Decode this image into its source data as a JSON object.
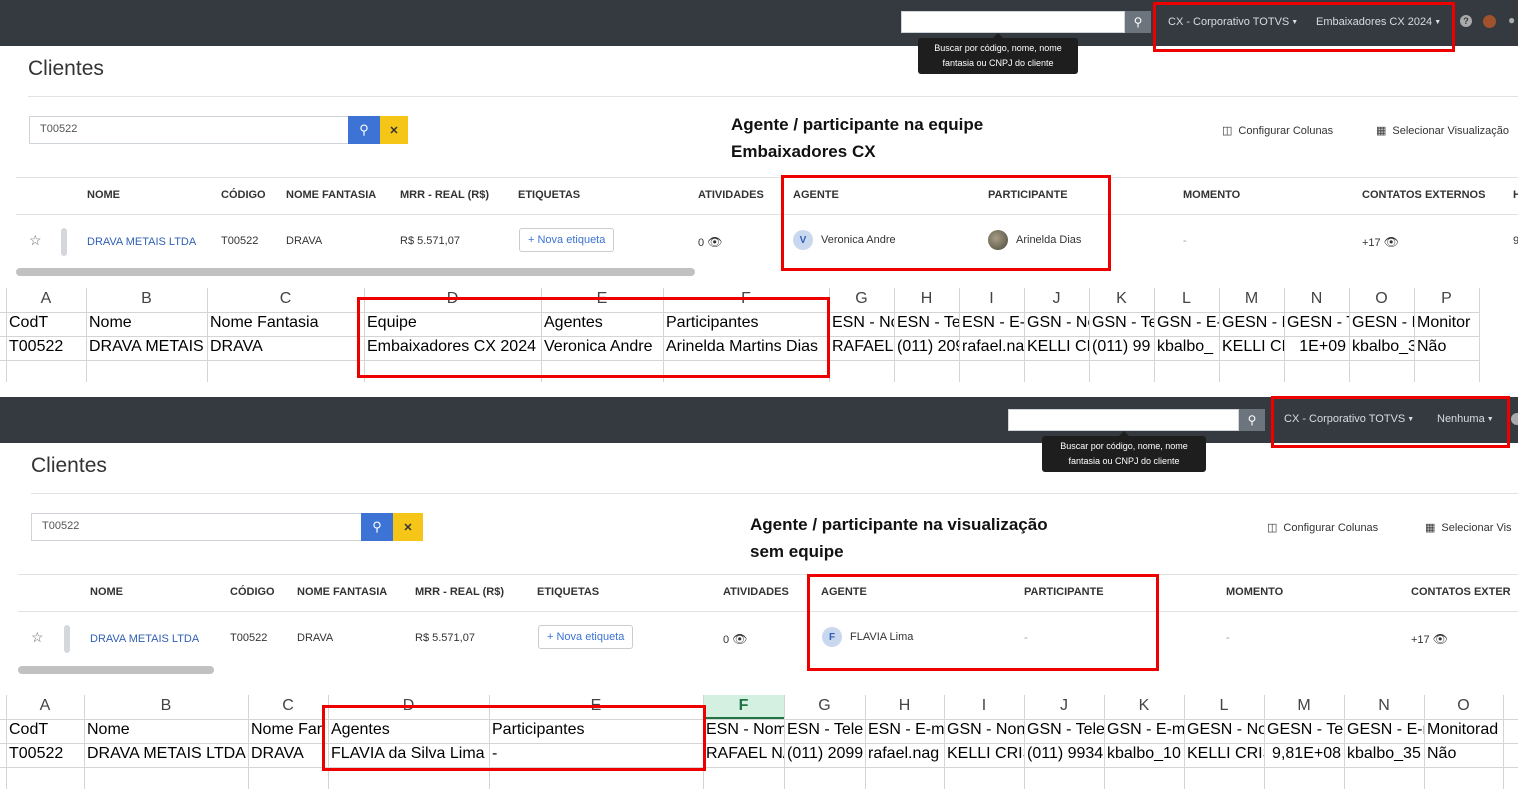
{
  "top": {
    "nav": {
      "search_value": "",
      "tooltip_line1": "Buscar por código, nome, nome",
      "tooltip_line2": "fantasia ou CNPJ do cliente",
      "org_dropdown": "CX - Corporativo TOTVS",
      "team_dropdown": "Embaixadores CX 2024"
    },
    "page_title": "Clientes",
    "search_value": "T00522",
    "annotation_line1": "Agente / participante na equipe",
    "annotation_line2": "Embaixadores CX",
    "configure_columns": "Configurar Colunas",
    "select_view": "Selecionar Visualização",
    "headers": [
      "NOME",
      "CÓDIGO",
      "NOME FANTASIA",
      "MRR - REAL (R$)",
      "ETIQUETAS",
      "ATIVIDADES",
      "AGENTE",
      "PARTICIPANTE",
      "MOMENTO",
      "CONTATOS EXTERNOS",
      "H"
    ],
    "row": {
      "nome": "DRAVA METAIS LTDA",
      "codigo": "T00522",
      "fantasia": "DRAVA",
      "mrr": "R$ 5.571,07",
      "etiqueta": "+ Nova etiqueta",
      "atividades": "0",
      "agente_initial": "V",
      "agente": "Veronica Andre",
      "participante": "Arinelda Dias",
      "momento": "-",
      "contatos": "+17",
      "extra": "9"
    }
  },
  "sheet1": {
    "col_letters": [
      "A",
      "B",
      "C",
      "D",
      "E",
      "F",
      "G",
      "H",
      "I",
      "J",
      "K",
      "L",
      "M",
      "N",
      "O",
      "P"
    ],
    "header": [
      "CodT",
      "Nome",
      "Nome Fantasia",
      "Equipe",
      "Agentes",
      "Participantes",
      "ESN - No",
      "ESN - Te",
      "ESN - E-r",
      "GSN - No",
      "GSN - Te",
      "GSN - E-",
      "GESN - N",
      "GESN - T",
      "GESN - E",
      "Monitor"
    ],
    "row": [
      "T00522",
      "DRAVA METAIS",
      "DRAVA",
      "Embaixadores CX 2024",
      "Veronica Andre",
      "Arinelda Martins Dias",
      "RAFAEL",
      "(011) 209",
      "rafael.na",
      "KELLI CR",
      "(011) 99",
      "kbalbo_",
      "KELLI CR",
      "1E+09",
      "kbalbo_3",
      "Não"
    ]
  },
  "bottom": {
    "nav": {
      "search_value": "",
      "tooltip_line1": "Buscar por código, nome, nome",
      "tooltip_line2": "fantasia ou CNPJ do cliente",
      "org_dropdown": "CX - Corporativo TOTVS",
      "team_dropdown": "Nenhuma"
    },
    "page_title": "Clientes",
    "search_value": "T00522",
    "annotation_line1": "Agente / participante na visualização",
    "annotation_line2": "sem equipe",
    "configure_columns": "Configurar Colunas",
    "select_view": "Selecionar Vis",
    "headers": [
      "NOME",
      "CÓDIGO",
      "NOME FANTASIA",
      "MRR - REAL (R$)",
      "ETIQUETAS",
      "ATIVIDADES",
      "AGENTE",
      "PARTICIPANTE",
      "MOMENTO",
      "CONTATOS EXTER"
    ],
    "row": {
      "nome": "DRAVA METAIS LTDA",
      "codigo": "T00522",
      "fantasia": "DRAVA",
      "mrr": "R$ 5.571,07",
      "etiqueta": "+ Nova etiqueta",
      "atividades": "0",
      "agente_initial": "F",
      "agente": "FLAVIA Lima",
      "participante": "-",
      "momento": "-",
      "contatos": "+17"
    }
  },
  "sheet2": {
    "col_letters": [
      "A",
      "B",
      "C",
      "D",
      "E",
      "F",
      "G",
      "H",
      "I",
      "J",
      "K",
      "L",
      "M",
      "N",
      "O"
    ],
    "header": [
      "CodT",
      "Nome",
      "Nome Far",
      "Agentes",
      "Participantes",
      "ESN - Nom",
      "ESN - Tele",
      "ESN - E-ma",
      "GSN - Non",
      "GSN - Tele",
      "GSN - E-ma",
      "GESN - No",
      "GESN - Tel",
      "GESN - E-n",
      "Monitorad"
    ],
    "row": [
      "T00522",
      "DRAVA METAIS LTDA",
      "DRAVA",
      "FLAVIA da Silva Lima",
      "-",
      "RAFAEL NA",
      "(011) 2099",
      "rafael.nag",
      "KELLI CRIS",
      "(011) 9934",
      "kbalbo_10",
      "KELLI CRIS",
      "9,81E+08",
      "kbalbo_35",
      "Não"
    ]
  },
  "icons": {
    "search": "search-icon",
    "clear": "close-icon",
    "help": "help-icon",
    "bell": "bell-icon",
    "eye": "eye-icon",
    "star": "star-icon",
    "columns": "columns-icon",
    "table": "table-icon"
  },
  "colors": {
    "navbar": "#343a40",
    "primary": "#3c73d4",
    "warning": "#f5c518",
    "annotation_box": "#e00000",
    "excel_green": "#217346"
  }
}
